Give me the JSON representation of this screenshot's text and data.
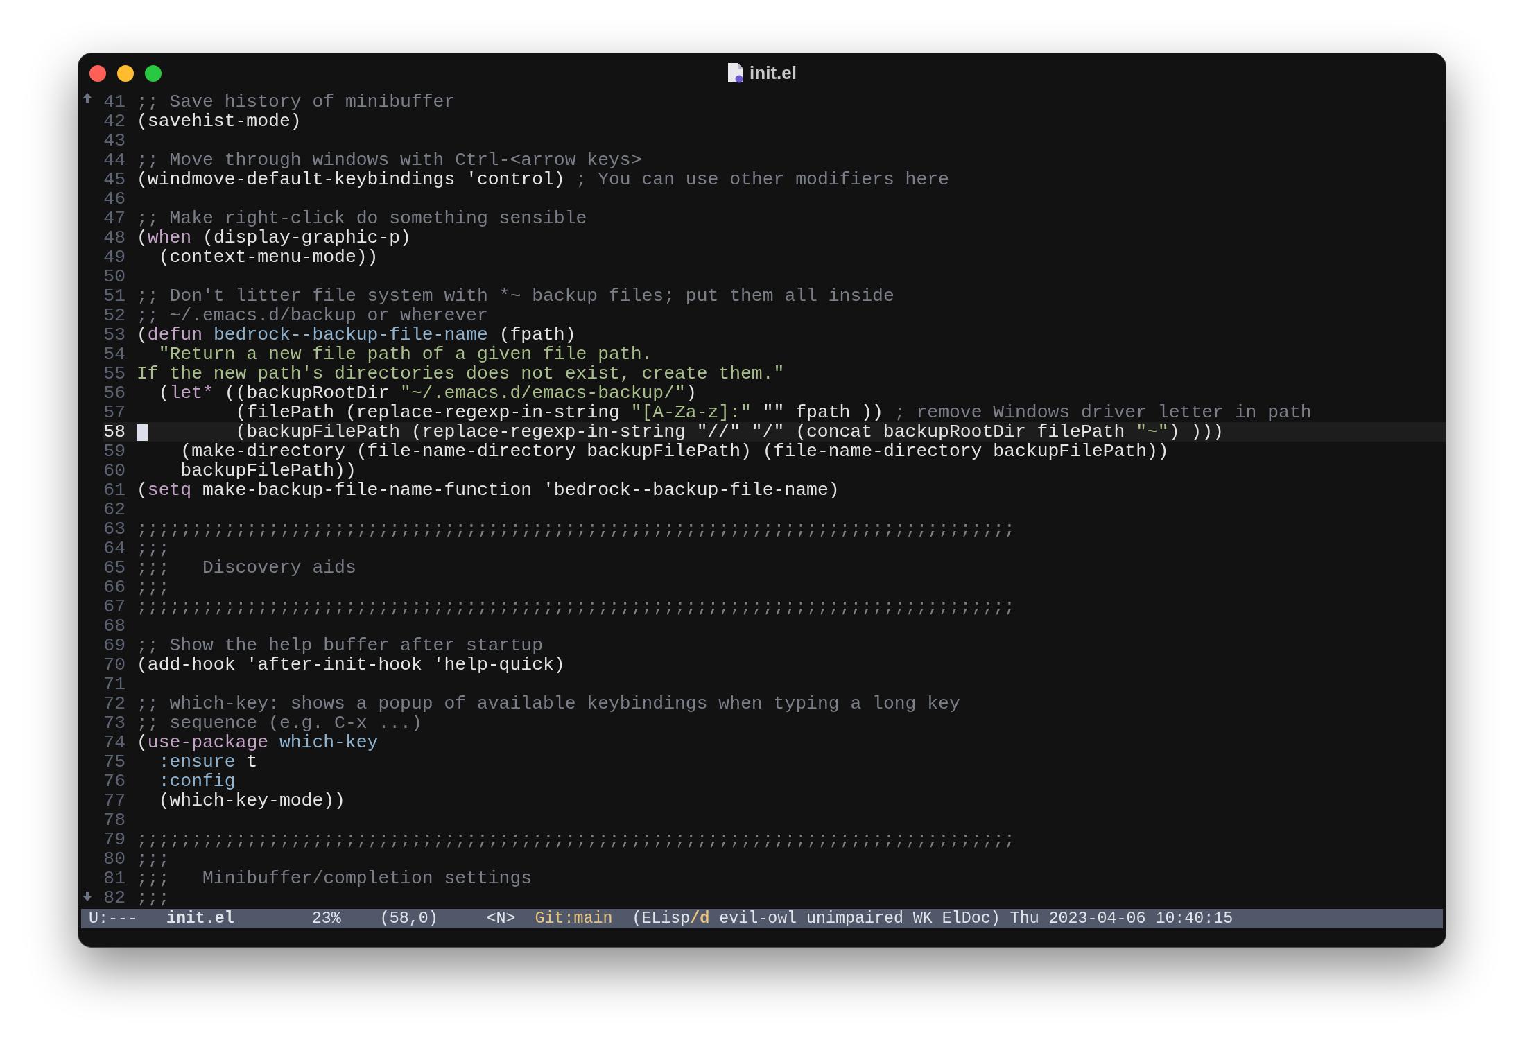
{
  "window": {
    "title": "init.el"
  },
  "editor": {
    "lines": [
      {
        "number": "41",
        "current": false,
        "tokens": [
          {
            "kind": "comment",
            "text": ";; Save history of minibuffer"
          }
        ]
      },
      {
        "number": "42",
        "current": false,
        "tokens": [
          {
            "kind": "plain",
            "text": "(savehist-mode)"
          }
        ]
      },
      {
        "number": "43",
        "current": false
      },
      {
        "number": "44",
        "current": false,
        "tokens": [
          {
            "kind": "comment",
            "text": ";; Move through windows with Ctrl-<arrow keys>"
          }
        ]
      },
      {
        "number": "45",
        "current": false,
        "tokens": [
          {
            "kind": "plain",
            "text": "(windmove-default-keybindings 'control) "
          },
          {
            "kind": "comment",
            "text": "; You can use other modifiers here"
          }
        ]
      },
      {
        "number": "46",
        "current": false
      },
      {
        "number": "47",
        "current": false,
        "tokens": [
          {
            "kind": "comment",
            "text": ";; Make right-click do something sensible"
          }
        ]
      },
      {
        "number": "48",
        "current": false,
        "tokens": [
          {
            "kind": "plain",
            "text": "("
          },
          {
            "kind": "keyword",
            "text": "when"
          },
          {
            "kind": "plain",
            "text": " (display-graphic-p)"
          }
        ]
      },
      {
        "number": "49",
        "current": false,
        "tokens": [
          {
            "kind": "plain",
            "text": "  (context-menu-mode))"
          }
        ]
      },
      {
        "number": "50",
        "current": false
      },
      {
        "number": "51",
        "current": false,
        "tokens": [
          {
            "kind": "comment",
            "text": ";; Don't litter file system with *~ backup files; put them all inside"
          }
        ]
      },
      {
        "number": "52",
        "current": false,
        "tokens": [
          {
            "kind": "comment",
            "text": ";; ~/.emacs.d/backup or wherever"
          }
        ]
      },
      {
        "number": "53",
        "current": false,
        "tokens": [
          {
            "kind": "plain",
            "text": "("
          },
          {
            "kind": "keyword",
            "text": "defun "
          },
          {
            "kind": "function",
            "text": "bedrock--backup-file-name"
          },
          {
            "kind": "plain",
            "text": " (fpath)"
          }
        ]
      },
      {
        "number": "54",
        "current": false,
        "tokens": [
          {
            "kind": "string",
            "text": "  \"Return a new file path of a given file path."
          }
        ]
      },
      {
        "number": "55",
        "current": false,
        "tokens": [
          {
            "kind": "string",
            "text": "If the new path's directories does not exist, create them.\""
          }
        ]
      },
      {
        "number": "56",
        "current": false,
        "tokens": [
          {
            "kind": "plain",
            "text": "  ("
          },
          {
            "kind": "keyword",
            "text": "let*"
          },
          {
            "kind": "plain",
            "text": " ((backupRootDir "
          },
          {
            "kind": "string",
            "text": "\"~/.emacs.d/emacs-backup/\""
          },
          {
            "kind": "plain",
            "text": ")"
          }
        ]
      },
      {
        "number": "57",
        "current": false,
        "tokens": [
          {
            "kind": "plain",
            "text": "         (filePath (replace-regexp-in-string "
          },
          {
            "kind": "string",
            "text": "\"[A-Za-z]:\""
          },
          {
            "kind": "plain",
            "text": " \"\" fpath )) "
          },
          {
            "kind": "comment",
            "text": "; remove Windows driver letter in path"
          }
        ]
      },
      {
        "number": "58",
        "current": true,
        "tokens": [
          {
            "kind": "plain",
            "text": "        (backupFilePath (replace-regexp-in-string \"//\" \"/\" (concat backupRootDir filePath "
          },
          {
            "kind": "string",
            "text": "\"~\""
          },
          {
            "kind": "plain",
            "text": ") )))"
          }
        ]
      },
      {
        "number": "59",
        "current": false,
        "tokens": [
          {
            "kind": "plain",
            "text": "    (make-directory (file-name-directory backupFilePath) (file-name-directory backupFilePath))"
          }
        ]
      },
      {
        "number": "60",
        "current": false,
        "tokens": [
          {
            "kind": "plain",
            "text": "    backupFilePath))"
          }
        ]
      },
      {
        "number": "61",
        "current": false,
        "tokens": [
          {
            "kind": "plain",
            "text": "("
          },
          {
            "kind": "keyword",
            "text": "setq"
          },
          {
            "kind": "plain",
            "text": " make-backup-file-name-function 'bedrock--backup-file-name)"
          }
        ]
      },
      {
        "number": "62",
        "current": false
      },
      {
        "number": "63",
        "current": false,
        "tokens": [
          {
            "kind": "comment",
            "text": ";;;;;;;;;;;;;;;;;;;;;;;;;;;;;;;;;;;;;;;;;;;;;;;;;;;;;;;;;;;;;;;;;;;;;;;;;;;;;;;;"
          }
        ]
      },
      {
        "number": "64",
        "current": false,
        "tokens": [
          {
            "kind": "comment",
            "text": ";;;"
          }
        ]
      },
      {
        "number": "65",
        "current": false,
        "tokens": [
          {
            "kind": "comment",
            "text": ";;;   Discovery aids"
          }
        ]
      },
      {
        "number": "66",
        "current": false,
        "tokens": [
          {
            "kind": "comment",
            "text": ";;;"
          }
        ]
      },
      {
        "number": "67",
        "current": false,
        "tokens": [
          {
            "kind": "comment",
            "text": ";;;;;;;;;;;;;;;;;;;;;;;;;;;;;;;;;;;;;;;;;;;;;;;;;;;;;;;;;;;;;;;;;;;;;;;;;;;;;;;;"
          }
        ]
      },
      {
        "number": "68",
        "current": false
      },
      {
        "number": "69",
        "current": false,
        "tokens": [
          {
            "kind": "comment",
            "text": ";; Show the help buffer after startup"
          }
        ]
      },
      {
        "number": "70",
        "current": false,
        "tokens": [
          {
            "kind": "plain",
            "text": "(add-hook 'after-init-hook 'help-quick)"
          }
        ]
      },
      {
        "number": "71",
        "current": false
      },
      {
        "number": "72",
        "current": false,
        "tokens": [
          {
            "kind": "comment",
            "text": ";; which-key: shows a popup of available keybindings when typing a long key"
          }
        ]
      },
      {
        "number": "73",
        "current": false,
        "tokens": [
          {
            "kind": "comment",
            "text": ";; sequence (e.g. C-x ...)"
          }
        ]
      },
      {
        "number": "74",
        "current": false,
        "tokens": [
          {
            "kind": "plain",
            "text": "("
          },
          {
            "kind": "keyword",
            "text": "use-package "
          },
          {
            "kind": "function",
            "text": "which-key"
          }
        ]
      },
      {
        "number": "75",
        "current": false,
        "tokens": [
          {
            "kind": "constant",
            "text": "  :ensure"
          },
          {
            "kind": "plain",
            "text": " t"
          }
        ]
      },
      {
        "number": "76",
        "current": false,
        "tokens": [
          {
            "kind": "constant",
            "text": "  :config"
          }
        ]
      },
      {
        "number": "77",
        "current": false,
        "tokens": [
          {
            "kind": "plain",
            "text": "  (which-key-mode))"
          }
        ]
      },
      {
        "number": "78",
        "current": false
      },
      {
        "number": "79",
        "current": false,
        "tokens": [
          {
            "kind": "comment",
            "text": ";;;;;;;;;;;;;;;;;;;;;;;;;;;;;;;;;;;;;;;;;;;;;;;;;;;;;;;;;;;;;;;;;;;;;;;;;;;;;;;;"
          }
        ]
      },
      {
        "number": "80",
        "current": false,
        "tokens": [
          {
            "kind": "comment",
            "text": ";;;"
          }
        ]
      },
      {
        "number": "81",
        "current": false,
        "tokens": [
          {
            "kind": "comment",
            "text": ";;;   Minibuffer/completion settings"
          }
        ]
      },
      {
        "number": "82",
        "current": false,
        "tokens": [
          {
            "kind": "comment",
            "text": ";;;"
          }
        ]
      }
    ]
  },
  "mode_line": {
    "segments": [
      {
        "kind": "plain",
        "text": "U:---"
      },
      {
        "kind": "buffer",
        "text": "init.el"
      },
      {
        "kind": "plain",
        "text": "23%"
      },
      {
        "kind": "plain",
        "text": "(58,0)"
      },
      {
        "kind": "plain",
        "text": "<N>"
      },
      {
        "kind": "vcs",
        "text": "Git:main"
      },
      {
        "kind": "plain",
        "text": "(ELisp**/d** evil-owl unimpaired WK ElDoc)"
      },
      {
        "kind": "plain",
        "text": "Thu 2023-04-06 10:40:15"
      }
    ]
  }
}
